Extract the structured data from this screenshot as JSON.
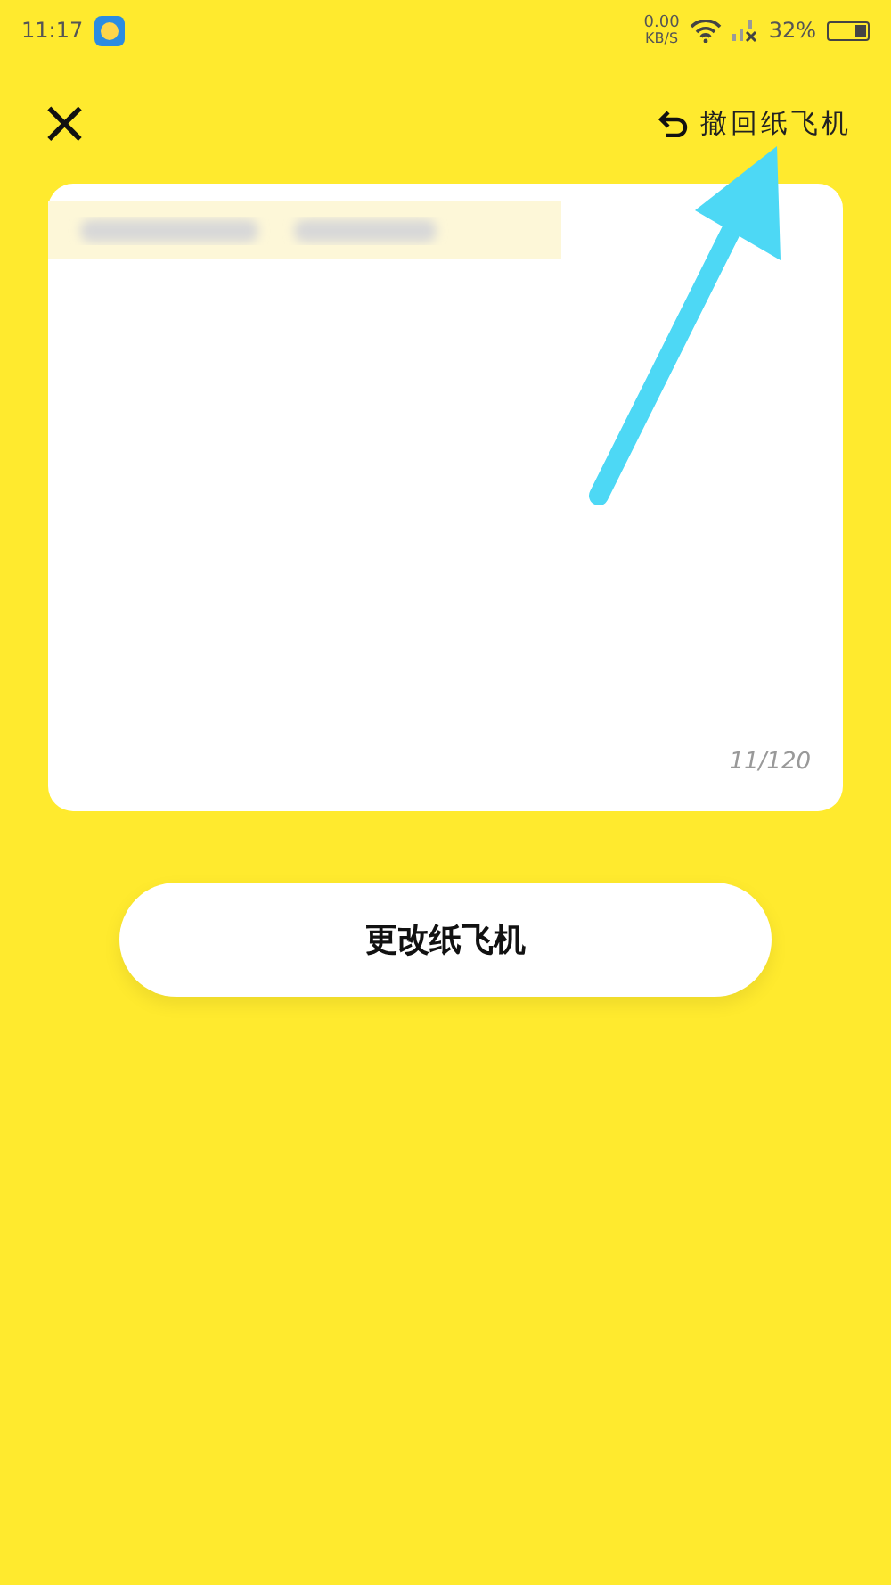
{
  "status_bar": {
    "time": "11:17",
    "speed_value": "0.00",
    "speed_unit": "KB/S",
    "battery_text": "32%",
    "battery": {
      "level": 0.32
    }
  },
  "header": {
    "close_icon": "×",
    "undo_label": "撤回纸飞机"
  },
  "note_card": {
    "counter": "11/120"
  },
  "primary_button": {
    "label": "更改纸飞机"
  }
}
